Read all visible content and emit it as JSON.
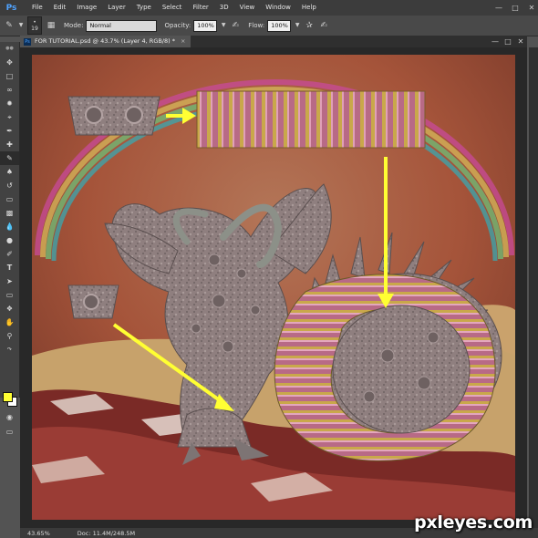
{
  "app": {
    "logo": "Ps"
  },
  "menu": [
    "File",
    "Edit",
    "Image",
    "Layer",
    "Type",
    "Select",
    "Filter",
    "3D",
    "View",
    "Window",
    "Help"
  ],
  "options": {
    "brush_size": "19",
    "mode_label": "Mode:",
    "mode_value": "Normal",
    "opacity_label": "Opacity:",
    "opacity_value": "100%",
    "flow_label": "Flow:",
    "flow_value": "100%"
  },
  "document": {
    "tab_title": "FOR TUTORIAL.psd @ 43.7% (Layer 4, RGB/8) *"
  },
  "status": {
    "zoom": "43.65%",
    "doc": "Doc: 11.4M/248.5M"
  },
  "colors": {
    "foreground": "#ffff33",
    "background": "#ffffff",
    "arrow": "#ffff33"
  },
  "watermark": "pxleyes.com"
}
